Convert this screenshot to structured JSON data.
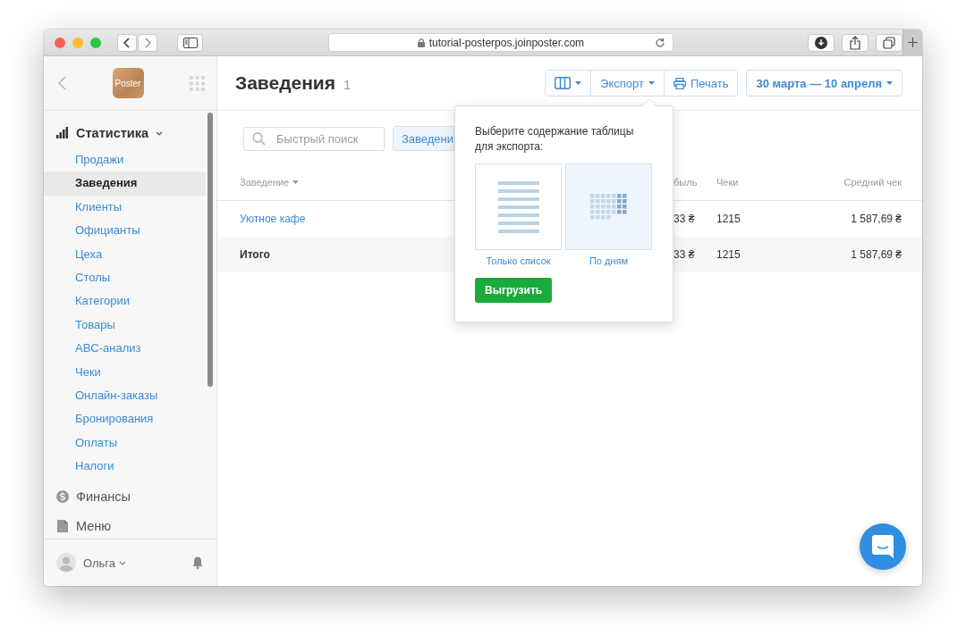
{
  "browser": {
    "url": "tutorial-posterpos.joinposter.com"
  },
  "sidebar": {
    "logo": "Poster",
    "sections": [
      {
        "label": "Статистика",
        "expanded": true,
        "children": [
          {
            "label": "Продажи",
            "selected": false
          },
          {
            "label": "Заведения",
            "selected": true
          },
          {
            "label": "Клиенты",
            "selected": false
          },
          {
            "label": "Официанты",
            "selected": false
          },
          {
            "label": "Цеха",
            "selected": false
          },
          {
            "label": "Столы",
            "selected": false
          },
          {
            "label": "Категории",
            "selected": false
          },
          {
            "label": "Товары",
            "selected": false
          },
          {
            "label": "ABC-анализ",
            "selected": false
          },
          {
            "label": "Чеки",
            "selected": false
          },
          {
            "label": "Онлайн-заказы",
            "selected": false
          },
          {
            "label": "Бронирования",
            "selected": false
          },
          {
            "label": "Оплаты",
            "selected": false
          },
          {
            "label": "Налоги",
            "selected": false
          }
        ]
      },
      {
        "label": "Финансы",
        "expanded": false
      },
      {
        "label": "Меню",
        "expanded": false
      }
    ],
    "user": {
      "name": "Ольга"
    }
  },
  "header": {
    "title": "Заведения",
    "count": "1",
    "export_button": "Экспорт",
    "print_button": "Печать",
    "date_range": "30 марта — 10 апреля"
  },
  "filters": {
    "search": {
      "placeholder": "Быстрый поиск"
    },
    "filter_button": "Заведени"
  },
  "export_popover": {
    "prompt": "Выберите содержание таблицы для экспорта:",
    "options": [
      {
        "label": "Только список",
        "selected": false
      },
      {
        "label": "По дням",
        "selected": true
      }
    ],
    "submit": "Выгрузить"
  },
  "table": {
    "columns": [
      {
        "label": "Заведение",
        "sorted": true
      },
      {
        "label": "быль",
        "sorted": false
      },
      {
        "label": "Чеки",
        "sorted": false
      },
      {
        "label": "Средний чек",
        "sorted": false
      }
    ],
    "rows": [
      {
        "kind": "item",
        "cells": [
          "Уютное кафе",
          "33 ₴",
          "1215",
          "1 587,69 ₴"
        ]
      },
      {
        "kind": "total",
        "cells": [
          "Итого",
          "33 ₴",
          "1215",
          "1 587,69 ₴"
        ]
      }
    ]
  }
}
